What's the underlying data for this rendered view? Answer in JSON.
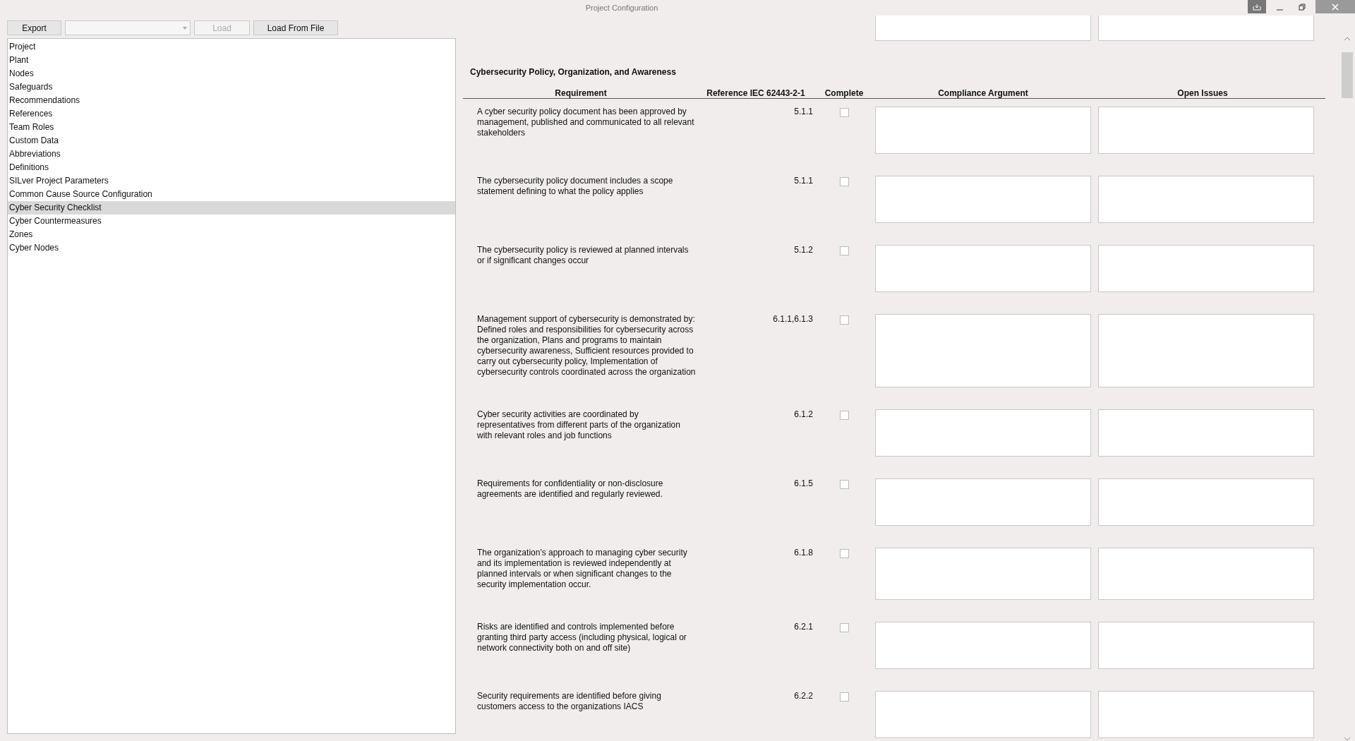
{
  "window": {
    "title": "Project Configuration"
  },
  "toolbar": {
    "export": {
      "label": "Export",
      "disabled": false
    },
    "load": {
      "label": "Load",
      "disabled": true
    },
    "load_from_file": {
      "label": "Load From File",
      "disabled": false
    }
  },
  "sidebar": {
    "items": [
      {
        "label": "Project",
        "selected": false
      },
      {
        "label": "Plant",
        "selected": false
      },
      {
        "label": "Nodes",
        "selected": false
      },
      {
        "label": "Safeguards",
        "selected": false
      },
      {
        "label": "Recommendations",
        "selected": false
      },
      {
        "label": "References",
        "selected": false
      },
      {
        "label": "Team Roles",
        "selected": false
      },
      {
        "label": "Custom Data",
        "selected": false
      },
      {
        "label": "Abbreviations",
        "selected": false
      },
      {
        "label": "Definitions",
        "selected": false
      },
      {
        "label": "SILver Project Parameters",
        "selected": false
      },
      {
        "label": "Common Cause Source Configuration",
        "selected": false
      },
      {
        "label": "Cyber Security Checklist",
        "selected": true
      },
      {
        "label": "Cyber Countermeasures",
        "selected": false
      },
      {
        "label": "Zones",
        "selected": false
      },
      {
        "label": "Cyber Nodes",
        "selected": false
      }
    ]
  },
  "checklist": {
    "section_title": "Cybersecurity Policy, Organization, and Awareness",
    "columns": [
      "Requirement",
      "Reference IEC 62443-2-1",
      "Complete",
      "Compliance Argument",
      "Open Issues"
    ],
    "rows": [
      {
        "requirement": "A cyber security policy document has been approved by management, published and communicated to all relevant stakeholders",
        "reference": "5.1.1",
        "complete": false
      },
      {
        "requirement": "The cybersecurity policy document includes a scope statement defining to what the policy applies",
        "reference": "5.1.1",
        "complete": false
      },
      {
        "requirement": "The cybersecurity policy is reviewed at planned intervals or if significant changes occur",
        "reference": "5.1.2",
        "complete": false
      },
      {
        "requirement": "Management support of cybersecurity is demonstrated by: Defined roles and responsibilities for cybersecurity across the organization, Plans and programs to maintain cybersecurity awareness, Sufficient resources provided to carry out cybersecurity policy, Implementation of cybersecurity controls coordinated across the organization",
        "reference": "6.1.1,6.1.3",
        "complete": false
      },
      {
        "requirement": "Cyber security activities are coordinated by representatives from different parts of the organization with relevant roles and job functions",
        "reference": "6.1.2",
        "complete": false
      },
      {
        "requirement": "Requirements for confidentiality or non-disclosure agreements are identified and regularly reviewed.",
        "reference": "6.1.5",
        "complete": false
      },
      {
        "requirement": "The organization's approach to managing cyber security and its implementation is reviewed independently at planned intervals or when significant changes to the security implementation occur.",
        "reference": "6.1.8",
        "complete": false
      },
      {
        "requirement": "Risks are identified and controls implemented before granting third party access (including physical, logical or network connectivity both on and off site)",
        "reference": "6.2.1",
        "complete": false
      },
      {
        "requirement": "Security requirements are identified before giving customers access to the organizations IACS",
        "reference": "6.2.2",
        "complete": false
      }
    ]
  }
}
